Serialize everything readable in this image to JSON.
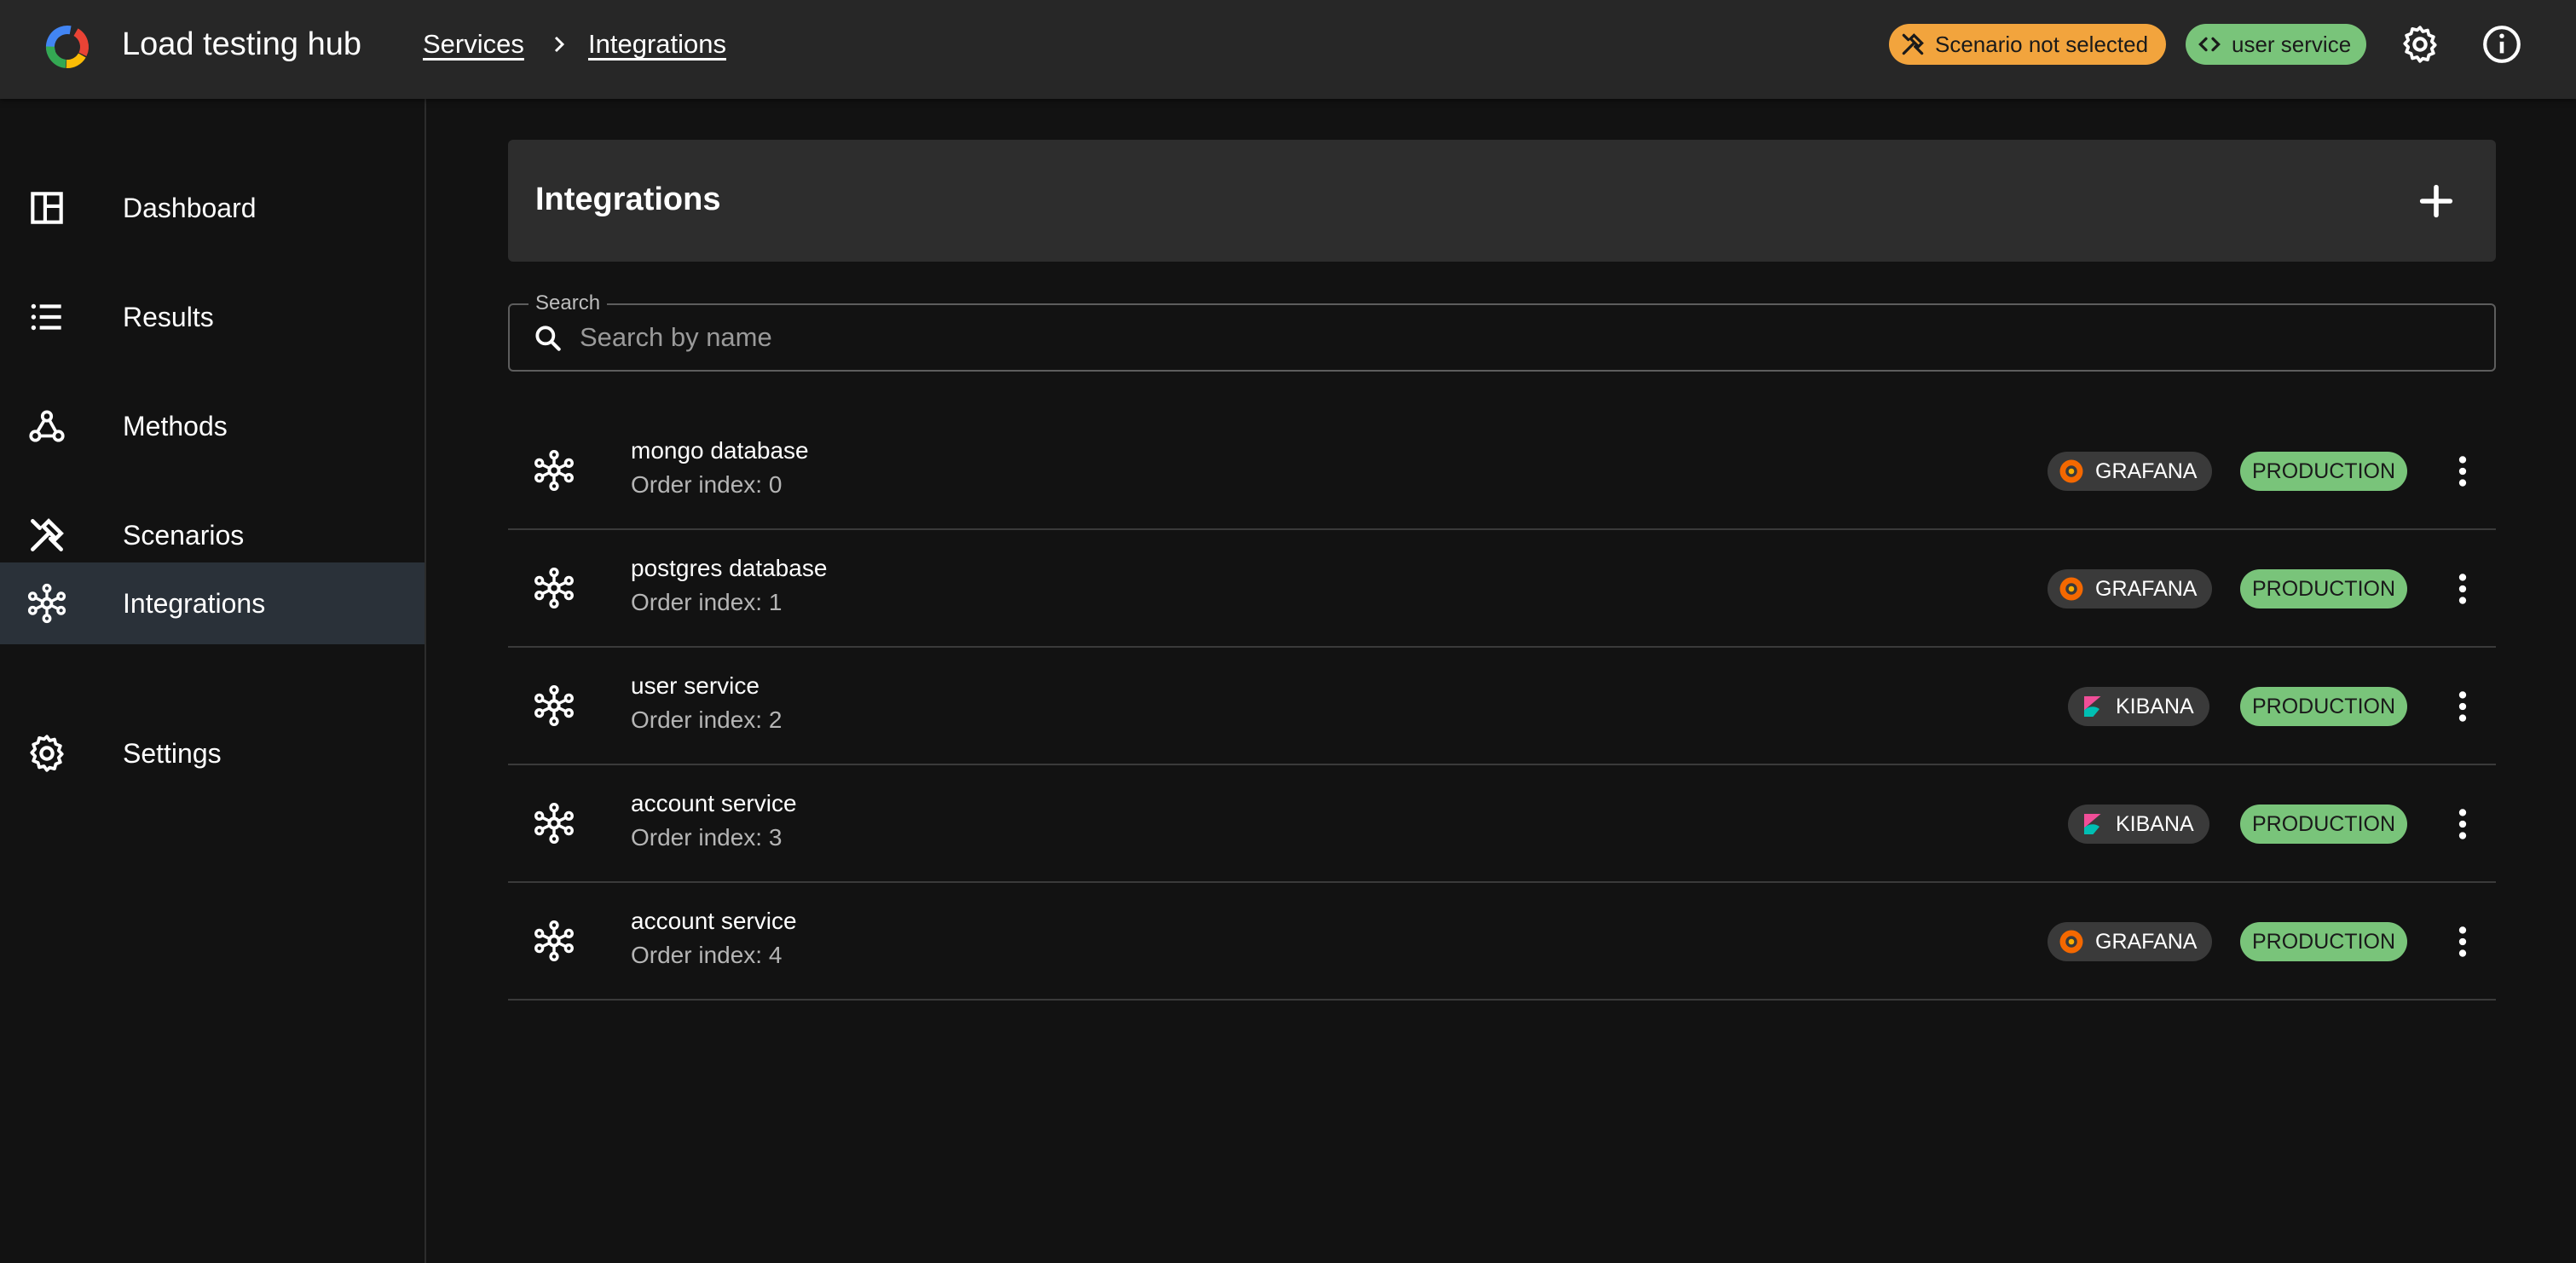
{
  "header": {
    "app_title": "Load testing hub",
    "breadcrumbs": [
      {
        "label": "Services"
      },
      {
        "label": "Integrations"
      }
    ],
    "scenario_chip": {
      "label": "Scenario not selected",
      "icon": "tools-icon",
      "color": "#f2a43d"
    },
    "service_chip": {
      "label": "user service",
      "icon": "code-icon",
      "color": "#79c47a"
    },
    "actions": [
      "gear-icon",
      "info-icon"
    ]
  },
  "sidebar": {
    "items": [
      {
        "label": "Dashboard",
        "icon": "dashboard-icon",
        "active": false
      },
      {
        "label": "Results",
        "icon": "list-icon",
        "active": false
      },
      {
        "label": "Methods",
        "icon": "webhook-icon",
        "active": false
      },
      {
        "label": "Scenarios",
        "icon": "tools-icon",
        "active": false
      },
      {
        "label": "Integrations",
        "icon": "hub-icon",
        "active": true
      },
      {
        "label": "Settings",
        "icon": "gear-icon",
        "active": false
      }
    ]
  },
  "main": {
    "title": "Integrations",
    "search": {
      "label": "Search",
      "placeholder": "Search by name",
      "value": ""
    },
    "integrations": [
      {
        "name": "mongo database",
        "order": "Order index: 0",
        "source": "GRAFANA",
        "environment": "PRODUCTION"
      },
      {
        "name": "postgres database",
        "order": "Order index: 1",
        "source": "GRAFANA",
        "environment": "PRODUCTION"
      },
      {
        "name": "user service",
        "order": "Order index: 2",
        "source": "KIBANA",
        "environment": "PRODUCTION"
      },
      {
        "name": "account service",
        "order": "Order index: 3",
        "source": "KIBANA",
        "environment": "PRODUCTION"
      },
      {
        "name": "account service",
        "order": "Order index: 4",
        "source": "GRAFANA",
        "environment": "PRODUCTION"
      }
    ]
  },
  "colors": {
    "background": "#121212",
    "topbar": "#272727",
    "panel": "#2d2d2d",
    "active_nav": "#2a3139",
    "production_chip": "#79c47a",
    "warning_chip": "#f2a43d"
  }
}
